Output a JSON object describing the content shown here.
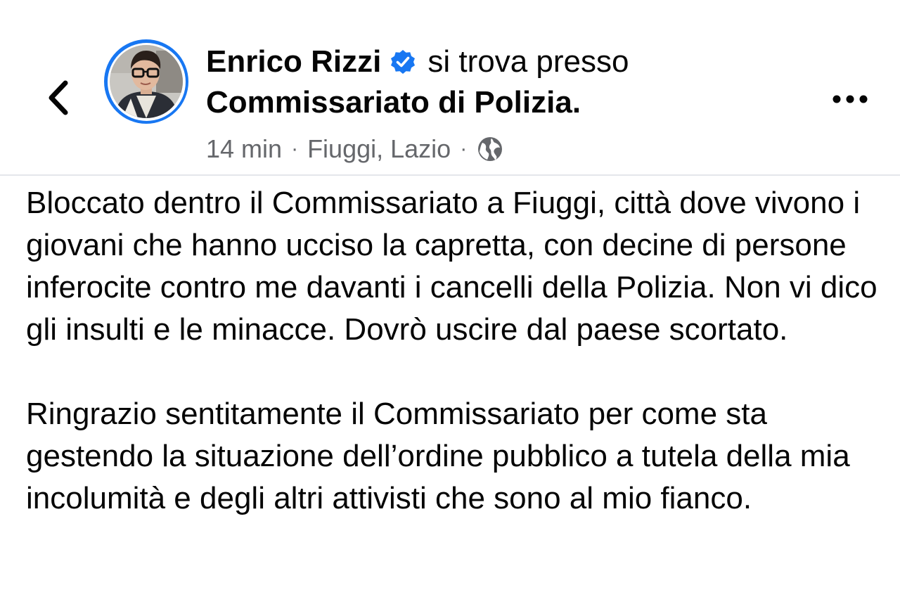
{
  "header": {
    "back_icon": "chevron-left-icon",
    "avatar_icon": "profile-photo",
    "author_name": "Enrico Rizzi",
    "verified_icon": "verified-badge-icon",
    "action_text": "si trova presso",
    "place_name": "Commissariato di Polizia",
    "place_suffix": ".",
    "time": "14 min",
    "separator": "·",
    "location": "Fiuggi, Lazio",
    "audience_icon": "globe-icon",
    "more_icon": "more-horizontal-icon"
  },
  "post": {
    "paragraphs": [
      "Bloccato dentro il Commissariato a Fiuggi, città dove vivono i giovani che hanno ucciso la capretta, con decine di persone inferocite contro me davanti i cancelli della Polizia. Non vi dico gli insulti e le minacce. Dovrò uscire dal paese scortato.",
      "Ringrazio sentitamente il Commissariato per come sta gestendo la situazione dell’ordine pubblico a tutela della mia incolumità e degli altri attivisti che sono al mio fianco."
    ]
  },
  "colors": {
    "accent_blue": "#1877f2",
    "text_primary": "#050505",
    "text_secondary": "#65676b",
    "divider": "#e4e6eb"
  }
}
